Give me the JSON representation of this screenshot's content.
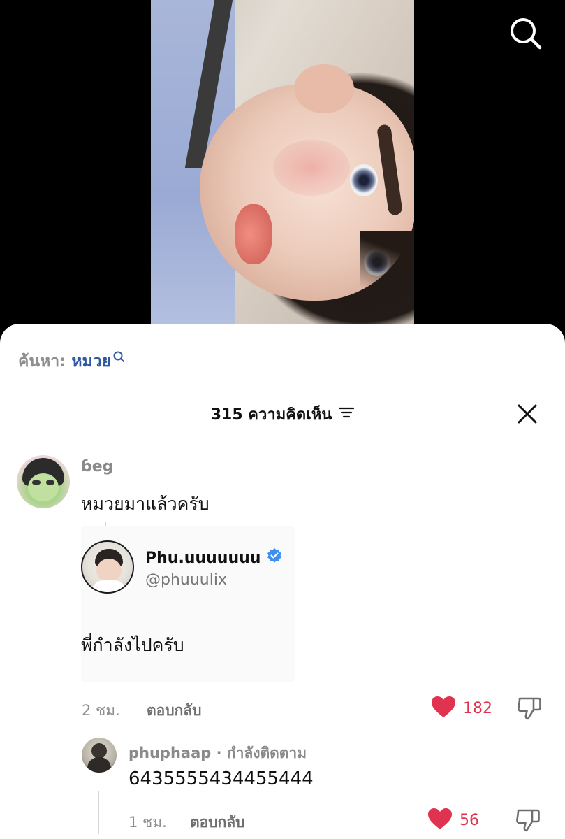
{
  "video": {
    "search_icon": "search-icon"
  },
  "sheet": {
    "search": {
      "prefix": "ค้นหา:",
      "term": "หมวย",
      "icon": "search-icon"
    },
    "header": {
      "title": "315 ความคิดเห็น",
      "sort_icon": "sort-icon",
      "close_icon": "close-icon"
    },
    "comments": [
      {
        "username": "ɓeg",
        "text": "หมวยมาแล้วครับ",
        "embed": {
          "display_name": "Phu.uuuuuuu",
          "handle": "@phuuulix",
          "verified": true,
          "text": "พี่กำลังไปครับ"
        },
        "time": "2 ชม.",
        "reply_label": "ตอบกลับ",
        "likes": "182"
      },
      {
        "username": "phuphaap · กำลังติดตาม",
        "text": "6435555434455444",
        "time": "1 ชม.",
        "reply_label": "ตอบกลับ",
        "likes": "56"
      }
    ]
  },
  "colors": {
    "like": "#e0334f",
    "search_term": "#2f57a2",
    "verified": "#3d8ff0"
  }
}
